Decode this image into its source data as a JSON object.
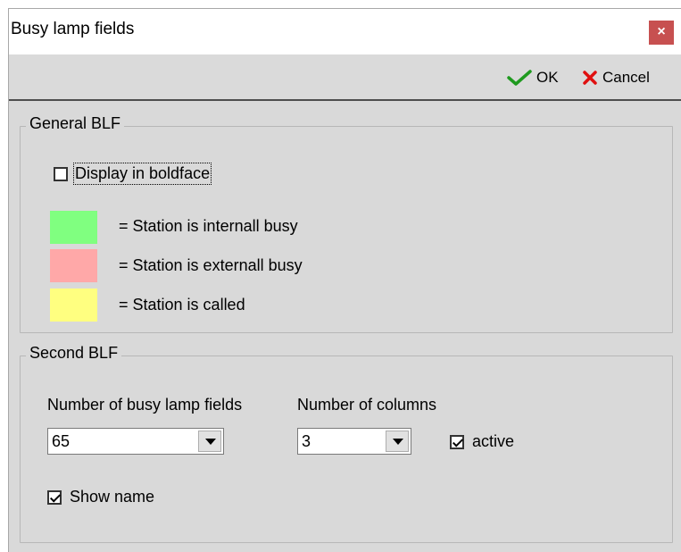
{
  "window": {
    "title": "Busy lamp fields",
    "close_glyph": "×"
  },
  "toolbar": {
    "ok_label": "OK",
    "cancel_label": "Cancel",
    "ok_icon": "check-icon",
    "cancel_icon": "x-icon"
  },
  "general": {
    "legend": "General BLF",
    "boldface_label": "Display in boldface",
    "boldface_checked": false,
    "legend_items": [
      {
        "color": "#80ff80",
        "label": "= Station is internall busy"
      },
      {
        "color": "#ffa8a8",
        "label": "= Station is externall busy"
      },
      {
        "color": "#ffff80",
        "label": "= Station is called"
      }
    ]
  },
  "second": {
    "legend": "Second BLF",
    "num_fields_label": "Number of busy lamp fields",
    "num_fields_value": "65",
    "num_columns_label": "Number of columns",
    "num_columns_value": "3",
    "active_label": "active",
    "active_checked": true,
    "show_name_label": "Show name",
    "show_name_checked": true
  }
}
